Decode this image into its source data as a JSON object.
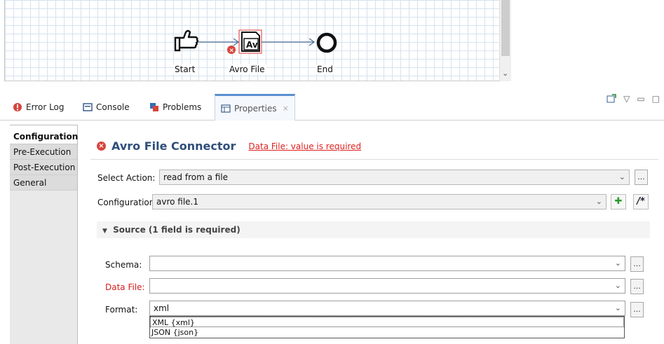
{
  "canvas": {
    "nodes": [
      {
        "label": "Start",
        "icon": "hand-pointing-icon"
      },
      {
        "label": "Avro File",
        "icon": "avro-file-icon",
        "badge": "Av"
      },
      {
        "label": "End",
        "icon": "end-circle-icon"
      }
    ]
  },
  "tabs": [
    {
      "label": "Error Log",
      "icon": "error-log-icon"
    },
    {
      "label": "Console",
      "icon": "console-icon"
    },
    {
      "label": "Problems",
      "icon": "problems-icon"
    },
    {
      "label": "Properties",
      "icon": "properties-icon",
      "active": true,
      "close": "×"
    }
  ],
  "nav": [
    "Configuration",
    "Pre-Execution",
    "Post-Execution",
    "General"
  ],
  "header": {
    "title": "Avro File Connector",
    "error": "Data File: value is required"
  },
  "form": {
    "select_action_label": "Select Action:",
    "select_action_value": "read from a file",
    "configuration_label": "Configuration:",
    "configuration_value": "avro file.1",
    "section": "Source (1 field is required)",
    "schema_label": "Schema:",
    "schema_value": "",
    "data_file_label": "Data File:",
    "data_file_value": "",
    "format_label": "Format:",
    "format_value": "xml",
    "dots": "...",
    "format_options": [
      "XML {xml}",
      "JSON {json}"
    ]
  },
  "colors": {
    "accent": "#5a8fd0",
    "error": "#e02020",
    "title": "#2f4e7b"
  }
}
